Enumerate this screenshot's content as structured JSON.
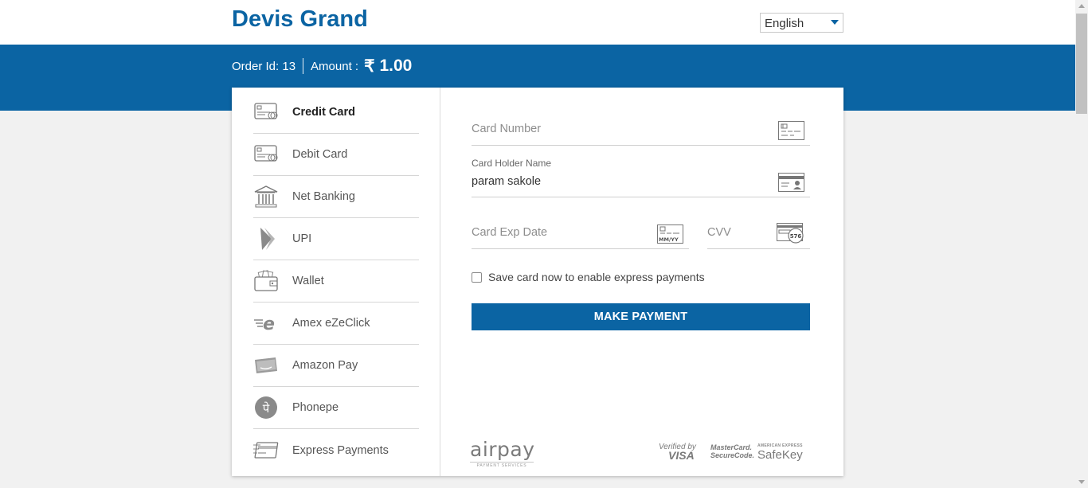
{
  "header": {
    "brand": "Devis Grand",
    "language": "English"
  },
  "order": {
    "order_id_label": "Order Id: 13",
    "amount_label": "Amount :",
    "currency_symbol": "₹",
    "amount_value": "1.00"
  },
  "sidebar": {
    "items": [
      {
        "label": "Credit Card",
        "icon": "credit-card-icon",
        "active": true
      },
      {
        "label": "Debit Card",
        "icon": "debit-card-icon",
        "active": false
      },
      {
        "label": "Net Banking",
        "icon": "bank-icon",
        "active": false
      },
      {
        "label": "UPI",
        "icon": "upi-icon",
        "active": false
      },
      {
        "label": "Wallet",
        "icon": "wallet-icon",
        "active": false
      },
      {
        "label": "Amex eZeClick",
        "icon": "amex-ezeclick-icon",
        "active": false
      },
      {
        "label": "Amazon Pay",
        "icon": "amazon-pay-icon",
        "active": false
      },
      {
        "label": "Phonepe",
        "icon": "phonepe-icon",
        "active": false
      },
      {
        "label": "Express Payments",
        "icon": "express-payments-icon",
        "active": false
      }
    ]
  },
  "form": {
    "card_number_placeholder": "Card Number",
    "holder_label": "Card Holder Name",
    "holder_value": "param sakole",
    "exp_placeholder": "Card Exp Date",
    "cvv_placeholder": "CVV",
    "exp_icon_text": "MM/YY",
    "cvv_icon_text": "576",
    "save_label": "Save card now to enable express payments",
    "pay_button": "MAKE PAYMENT"
  },
  "footer": {
    "airpay": "airpay",
    "airpay_sub": "PAYMENT SERVICES",
    "verified_line1": "Verified by",
    "verified_line2": "VISA",
    "mastercard_line1": "MasterCard.",
    "mastercard_line2": "SecureCode.",
    "amex_top": "AMERICAN EXPRESS",
    "amex_main": "SafeKey"
  },
  "colors": {
    "brand_blue": "#0b64a3",
    "background": "#f1f1f1"
  }
}
